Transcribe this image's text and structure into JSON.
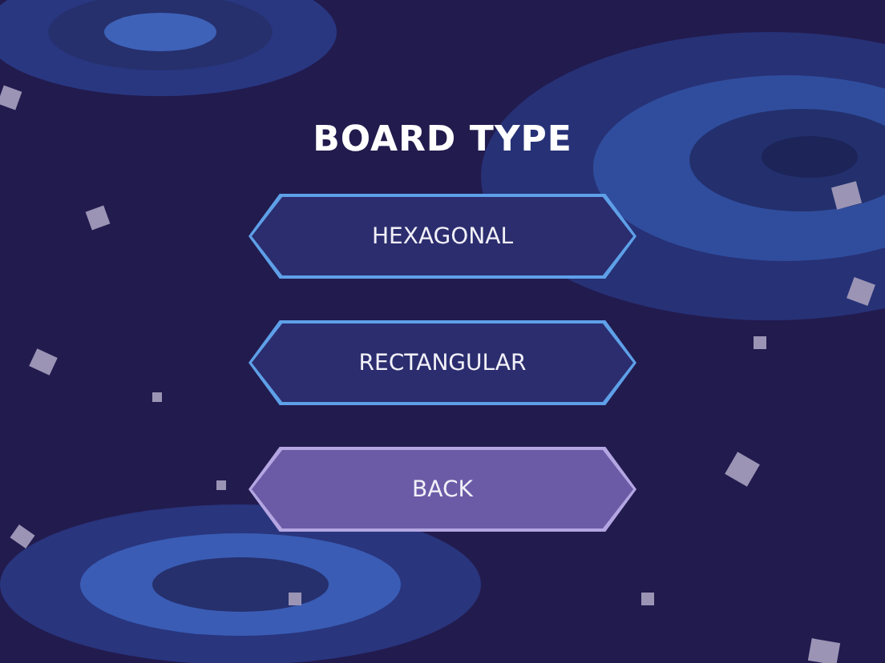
{
  "title": "BOARD TYPE",
  "buttons": [
    {
      "label": "HEXAGONAL",
      "kind": "option"
    },
    {
      "label": "RECTANGULAR",
      "kind": "option"
    },
    {
      "label": "BACK",
      "kind": "back"
    }
  ]
}
